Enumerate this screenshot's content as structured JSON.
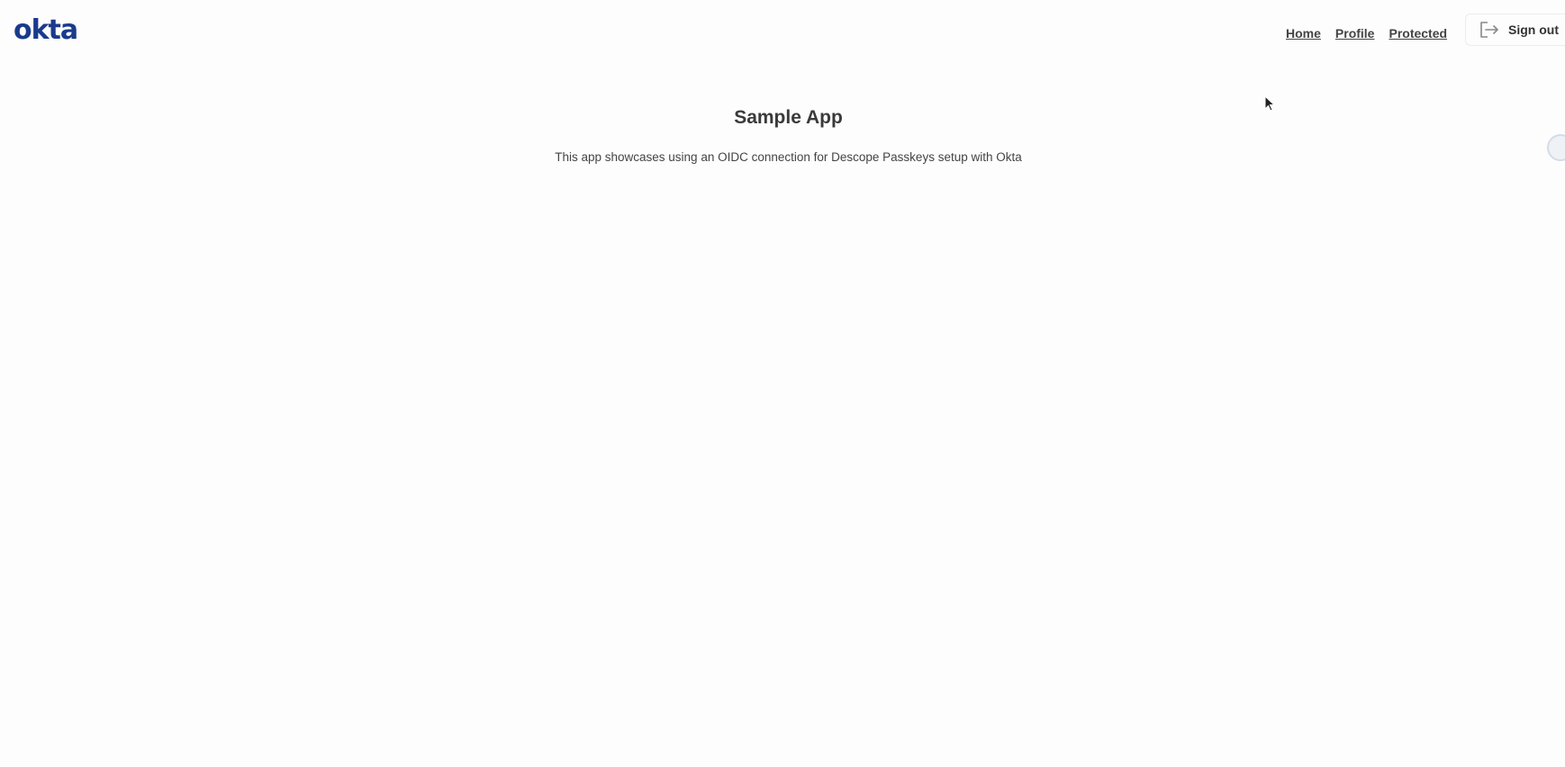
{
  "header": {
    "logo_text": "okta",
    "nav": {
      "home": "Home",
      "profile": "Profile",
      "protected": "Protected"
    },
    "sign_out_label": "Sign out"
  },
  "main": {
    "title": "Sample App",
    "description": "This app showcases using an OIDC connection for Descope Passkeys setup with Okta"
  },
  "icons": {
    "sign_out": "sign-out-icon",
    "cursor": "mouse-pointer-icon"
  },
  "colors": {
    "brand": "#1a3a8c",
    "background": "#fdfdfd"
  }
}
